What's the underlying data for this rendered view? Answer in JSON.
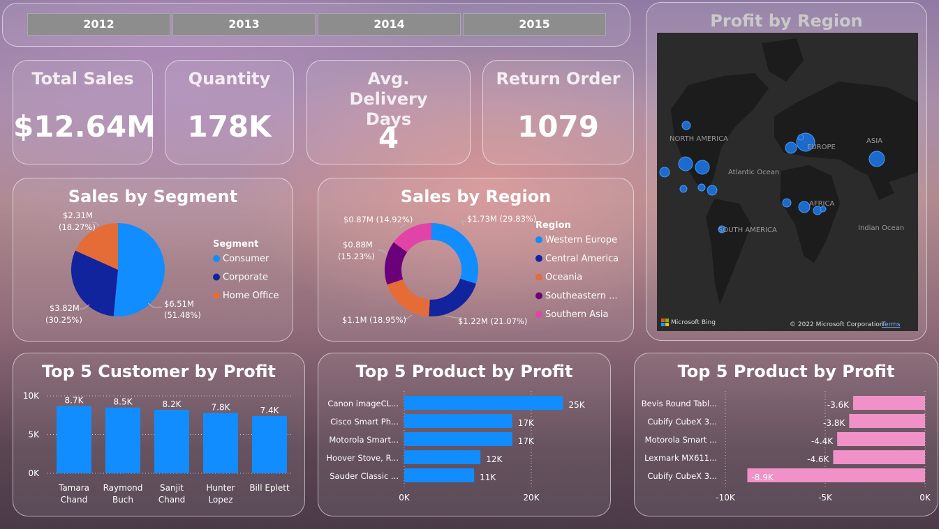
{
  "years": [
    "2012",
    "2013",
    "2014",
    "2015"
  ],
  "kpis": {
    "total_sales": {
      "title": "Total Sales",
      "value": "$12.64M"
    },
    "quantity": {
      "title": "Quantity",
      "value": "178K"
    },
    "delivery": {
      "title": "Avg. Delivery Days",
      "value": "4"
    },
    "returns": {
      "title": "Return Order",
      "value": "1079"
    }
  },
  "map": {
    "title": "Profit by Region",
    "labels": [
      "NORTH AMERICA",
      "EUROPE",
      "ASIA",
      "Atlantic Ocean",
      "AFRICA",
      "SOUTH AMERICA",
      "Indian Ocean"
    ],
    "attribution": "Microsoft Bing",
    "copyright": "© 2022 Microsoft Corporation",
    "terms": "Terms"
  },
  "segment_chart": {
    "title": "Sales by Segment",
    "legend_title": "Segment",
    "colors": {
      "Consumer": "#118dff",
      "Corporate": "#12239e",
      "Home Office": "#e66c37"
    },
    "labels": [
      {
        "value": "$6.51M",
        "pct": "(51.48%)"
      },
      {
        "value": "$3.82M",
        "pct": "(30.25%)"
      },
      {
        "value": "$2.31M",
        "pct": "(18.27%)"
      }
    ]
  },
  "region_chart": {
    "title": "Sales by Region",
    "legend_title": "Region",
    "legend_items": [
      "Western Europe",
      "Central America",
      "Oceania",
      "Southeastern ...",
      "Southern Asia"
    ],
    "colors": [
      "#118dff",
      "#12239e",
      "#e66c37",
      "#6b007b",
      "#e044a7"
    ],
    "labels": [
      "$1.73M (29.83%)",
      "$1.22M (21.07%)",
      "$1.1M (18.95%)",
      "$0.88M",
      "(15.23%)",
      "$0.87M (14.92%)"
    ]
  },
  "customer_chart": {
    "title": "Top 5 Customer by Profit",
    "value_labels": [
      "8.7K",
      "8.5K",
      "8.2K",
      "7.8K",
      "7.4K"
    ],
    "category_lines": [
      [
        "Tamara",
        "Chand"
      ],
      [
        "Raymond",
        "Buch"
      ],
      [
        "Sanjit",
        "Chand"
      ],
      [
        "Hunter",
        "Lopez"
      ],
      [
        "Bill Eplett"
      ]
    ],
    "ticks": [
      "10K",
      "5K",
      "0K"
    ]
  },
  "product_chart": {
    "title": "Top 5 Product by Profit",
    "categories": [
      "Canon imageCL...",
      "Cisco Smart Ph...",
      "Motorola Smart...",
      "Hoover Stove, R...",
      "Sauder Classic ..."
    ],
    "value_labels": [
      "25K",
      "17K",
      "17K",
      "12K",
      "11K"
    ],
    "ticks": [
      "0K",
      "20K"
    ]
  },
  "loss_chart": {
    "title": "Top 5 Product by Profit",
    "categories": [
      "Bevis Round Tabl...",
      "Cubify CubeX 3...",
      "Motorola Smart ...",
      "Lexmark MX611...",
      "Cubify CubeX 3..."
    ],
    "value_labels": [
      "-3.6K",
      "-3.8K",
      "-4.4K",
      "-4.6K",
      "-8.9K"
    ],
    "ticks": [
      "-10K",
      "-5K",
      "0K"
    ]
  },
  "chart_data": [
    {
      "type": "pie",
      "title": "Sales by Segment",
      "categories": [
        "Consumer",
        "Corporate",
        "Home Office"
      ],
      "values": [
        6.51,
        3.82,
        2.31
      ],
      "percent": [
        51.48,
        30.25,
        18.27
      ],
      "legend": "right"
    },
    {
      "type": "pie",
      "title": "Sales by Region",
      "categories": [
        "Western Europe",
        "Central America",
        "Oceania",
        "Southeastern ...",
        "Southern Asia"
      ],
      "values": [
        1.73,
        1.22,
        1.1,
        0.88,
        0.87
      ],
      "percent": [
        29.83,
        21.07,
        18.95,
        15.23,
        14.92
      ],
      "legend": "right"
    },
    {
      "type": "bar",
      "title": "Top 5 Customer by Profit",
      "categories": [
        "Tamara Chand",
        "Raymond Buch",
        "Sanjit Chand",
        "Hunter Lopez",
        "Bill Eplett"
      ],
      "values": [
        8700,
        8500,
        8200,
        7800,
        7400
      ],
      "ylim": [
        0,
        10000
      ],
      "color": "#118dff"
    },
    {
      "type": "bar",
      "title": "Top 5 Product by Profit",
      "categories": [
        "Canon imageCL...",
        "Cisco Smart Ph...",
        "Motorola Smart...",
        "Hoover Stove, R...",
        "Sauder Classic ..."
      ],
      "values": [
        25000,
        17000,
        17000,
        12000,
        11000
      ],
      "xlim": [
        0,
        25000
      ],
      "color": "#118dff"
    },
    {
      "type": "bar",
      "title": "Top 5 Product by Profit",
      "categories": [
        "Bevis Round Tabl...",
        "Cubify CubeX 3...",
        "Motorola Smart ...",
        "Lexmark MX611...",
        "Cubify CubeX 3..."
      ],
      "values": [
        -3600,
        -3800,
        -4400,
        -4600,
        -8900
      ],
      "xlim": [
        -10000,
        0
      ],
      "color": "#f092c8"
    }
  ]
}
